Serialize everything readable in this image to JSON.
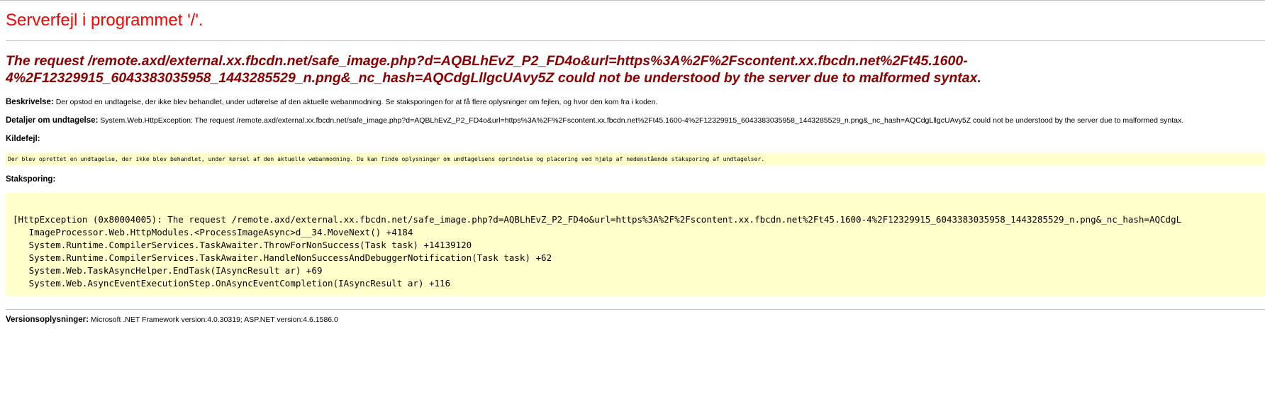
{
  "page": {
    "title": "Serverfejl i programmet '/'.",
    "error_message": "The request /remote.axd/external.xx.fbcdn.net/safe_image.php?d=AQBLhEvZ_P2_FD4o&url=https%3A%2F%2Fscontent.xx.fbcdn.net%2Ft45.1600-4%2F12329915_6043383035958_1443285529_n.png&_nc_hash=AQCdgLllgcUAvy5Z could not be understood by the server due to malformed syntax."
  },
  "description": {
    "label": "Beskrivelse:",
    "text": "Der opstod en undtagelse, der ikke blev behandlet, under udførelse af den aktuelle webanmodning. Se staksporingen for at få flere oplysninger om fejlen, og hvor den kom fra i koden."
  },
  "exception_details": {
    "label": "Detaljer om undtagelse:",
    "text": "System.Web.HttpException: The request /remote.axd/external.xx.fbcdn.net/safe_image.php?d=AQBLhEvZ_P2_FD4o&url=https%3A%2F%2Fscontent.xx.fbcdn.net%2Ft45.1600-4%2F12329915_6043383035958_1443285529_n.png&_nc_hash=AQCdgLllgcUAvy5Z could not be understood by the server due to malformed syntax."
  },
  "source_error": {
    "label": "Kildefejl:",
    "text": "Der blev oprettet en undtagelse, der ikke blev behandlet,  under kørsel af den aktuelle webanmodning. Du kan finde oplysninger om undtagelsens oprindelse og placering ved hjælp af nedenstående staksporing af undtagelser."
  },
  "stack_trace": {
    "label": "Staksporing:",
    "lines": [
      "[HttpException (0x80004005): The request /remote.axd/external.xx.fbcdn.net/safe_image.php?d=AQBLhEvZ_P2_FD4o&url=https%3A%2F%2Fscontent.xx.fbcdn.net%2Ft45.1600-4%2F12329915_6043383035958_1443285529_n.png&_nc_hash=AQCdgL",
      "   ImageProcessor.Web.HttpModules.<ProcessImageAsync>d__34.MoveNext() +4184",
      "   System.Runtime.CompilerServices.TaskAwaiter.ThrowForNonSuccess(Task task) +14139120",
      "   System.Runtime.CompilerServices.TaskAwaiter.HandleNonSuccessAndDebuggerNotification(Task task) +62",
      "   System.Web.TaskAsyncHelper.EndTask(IAsyncResult ar) +69",
      "   System.Web.AsyncEventExecutionStep.OnAsyncEventCompletion(IAsyncResult ar) +116"
    ]
  },
  "version_info": {
    "label": "Versionsoplysninger:",
    "text": "Microsoft .NET Framework version:4.0.30319; ASP.NET version:4.6.1586.0"
  },
  "colors": {
    "title": "#ff0000",
    "error_message": "#8b0000",
    "code_background": "#ffffcc",
    "rule": "#c0c0c0"
  }
}
